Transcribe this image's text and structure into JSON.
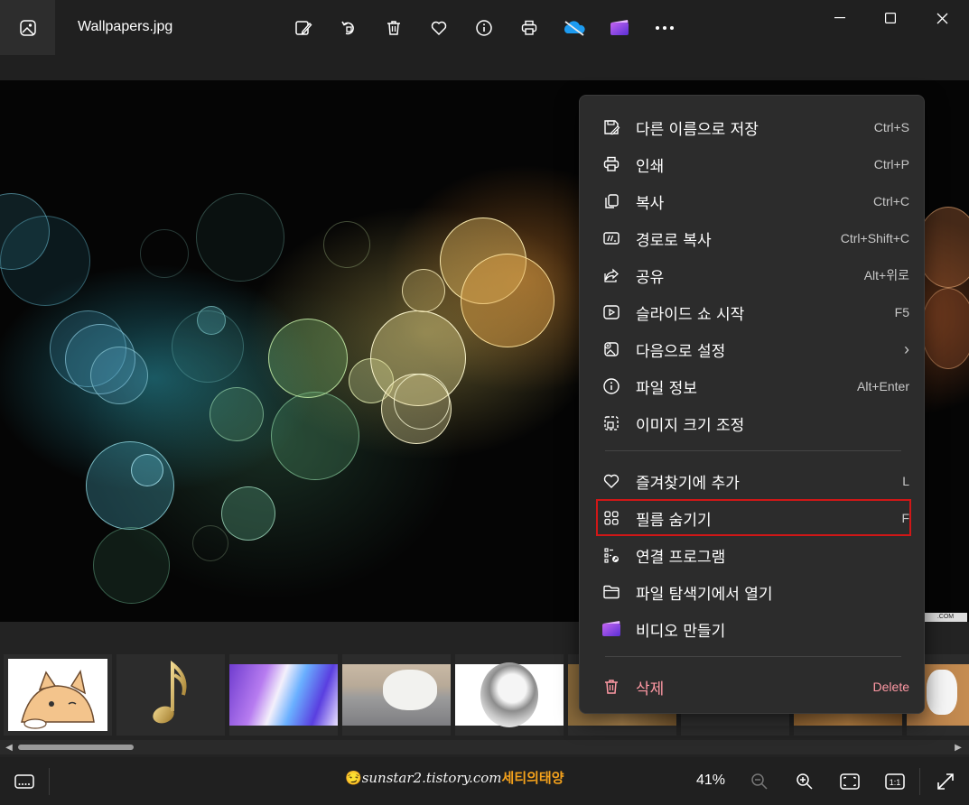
{
  "window": {
    "title": "Wallpapers.jpg"
  },
  "toolbar": {
    "items": [
      "edit-image",
      "rotate",
      "delete",
      "favorite",
      "file-info",
      "print",
      "onedrive",
      "clipchamp",
      "more"
    ]
  },
  "context_menu": {
    "group1": [
      {
        "label": "다른 이름으로 저장",
        "shortcut": "Ctrl+S",
        "icon": "save-as-icon"
      },
      {
        "label": "인쇄",
        "shortcut": "Ctrl+P",
        "icon": "print-icon"
      },
      {
        "label": "복사",
        "shortcut": "Ctrl+C",
        "icon": "copy-icon"
      },
      {
        "label": "경로로 복사",
        "shortcut": "Ctrl+Shift+C",
        "icon": "copy-path-icon"
      },
      {
        "label": "공유",
        "shortcut": "Alt+위로",
        "icon": "share-icon"
      },
      {
        "label": "슬라이드 쇼 시작",
        "shortcut": "F5",
        "icon": "slideshow-icon"
      },
      {
        "label": "다음으로 설정",
        "shortcut": "›",
        "icon": "set-as-icon"
      },
      {
        "label": "파일 정보",
        "shortcut": "Alt+Enter",
        "icon": "info-icon"
      },
      {
        "label": "이미지 크기 조정",
        "shortcut": "",
        "icon": "resize-icon"
      }
    ],
    "group2": [
      {
        "label": "즐겨찾기에 추가",
        "shortcut": "L",
        "icon": "heart-icon"
      },
      {
        "label": "필름 숨기기",
        "shortcut": "F",
        "icon": "grid-icon"
      },
      {
        "label": "연결 프로그램",
        "shortcut": "",
        "icon": "open-with-icon"
      },
      {
        "label": "파일 탐색기에서 열기",
        "shortcut": "",
        "icon": "folder-icon"
      },
      {
        "label": "비디오 만들기",
        "shortcut": "",
        "icon": "clipchamp-icon"
      }
    ],
    "delete": {
      "label": "삭제",
      "shortcut": "Delete",
      "icon": "trash-icon",
      "color": "#ff99a4"
    }
  },
  "bottom_bar": {
    "zoom": "41%",
    "watermark_latin": "sunstar2.tistory.com",
    "watermark_korean": "세티의태양"
  },
  "image_tag": ".COM",
  "colors": {
    "accent_red": "#d01717",
    "delete_pink": "#ff99a4"
  }
}
